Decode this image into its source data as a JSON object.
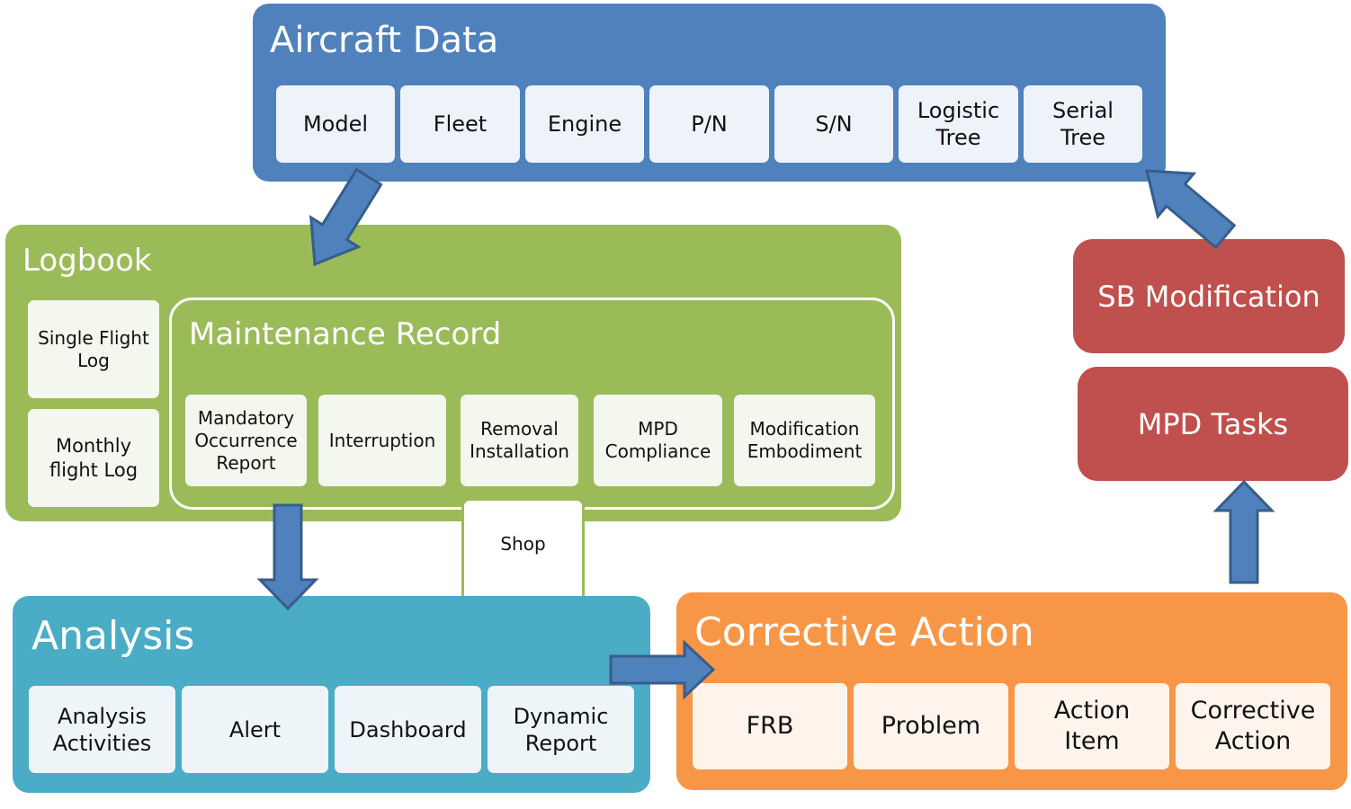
{
  "colors": {
    "aircraft_data": "#4f81bd",
    "logbook": "#9bbb59",
    "analysis": "#4bacc6",
    "corrective_action": "#f79646",
    "red_boxes": "#c0504d",
    "arrow": "#4f81bd"
  },
  "aircraft_data": {
    "title": "Aircraft Data",
    "items": [
      "Model",
      "Fleet",
      "Engine",
      "P/N",
      "S/N",
      "Logistic\nTree",
      "Serial\nTree"
    ]
  },
  "logbook": {
    "title": "Logbook",
    "logs": [
      "Single Flight\nLog",
      "Monthly\nflight Log"
    ],
    "maintenance_record": {
      "title": "Maintenance Record",
      "items": [
        "Mandatory\nOccurrence\nReport",
        "Interruption",
        "Removal\nInstallation",
        "MPD\nCompliance",
        "Modification\nEmbodiment"
      ]
    },
    "shop": "Shop"
  },
  "analysis": {
    "title": "Analysis",
    "items": [
      "Analysis\nActivities",
      "Alert",
      "Dashboard",
      "Dynamic\nReport"
    ]
  },
  "corrective_action": {
    "title": "Corrective Action",
    "items": [
      "FRB",
      "Problem",
      "Action\nItem",
      "Corrective\nAction"
    ]
  },
  "sb_modification": "SB Modification",
  "mpd_tasks": "MPD Tasks"
}
